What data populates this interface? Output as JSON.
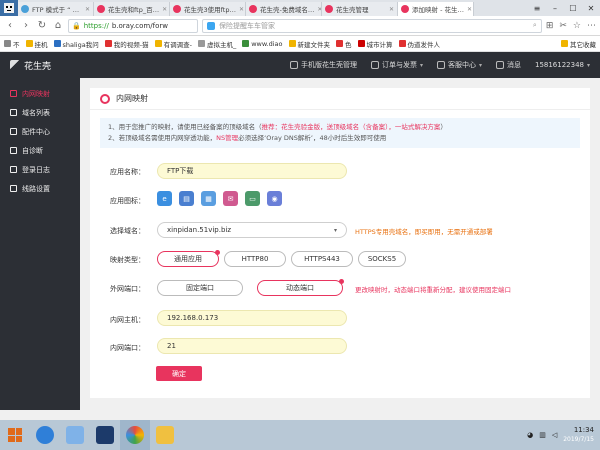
{
  "browser": {
    "avatar": "",
    "tabs": [
      {
        "label": "FTP 模式于 “ …",
        "color": "#4aa0d8",
        "active": false
      },
      {
        "label": "花生壳和ftp_百…",
        "color": "#e8345e",
        "active": false
      },
      {
        "label": "花生壳3使用ftp…",
        "color": "#e8345e",
        "active": false
      },
      {
        "label": "花生壳-免费域名…",
        "color": "#e8345e",
        "active": false
      },
      {
        "label": "花生壳管理",
        "color": "#e8345e",
        "active": false
      },
      {
        "label": "添加映射 - 花生…",
        "color": "#e8345e",
        "active": true
      }
    ],
    "url_scheme": "https://",
    "url_host": "b.oray.com/forw",
    "search_placeholder": "保险提醒车车管家",
    "bookmarks": [
      {
        "label": "不",
        "color": "#888"
      },
      {
        "label": "挂机",
        "color": "#f0b400"
      },
      {
        "label": "shaliga我问",
        "color": "#2b6fc2"
      },
      {
        "label": "我的视频-猫",
        "color": "#e03030"
      },
      {
        "label": "有调调查-",
        "color": "#f0b400"
      },
      {
        "label": "虚拟主机_",
        "color": "#999"
      },
      {
        "label": "www.diao",
        "color": "#3b8f3b"
      },
      {
        "label": "新建文件夹",
        "color": "#f0b400"
      },
      {
        "label": "色",
        "color": "#e03030"
      },
      {
        "label": "城市计算",
        "color": "#c00"
      },
      {
        "label": "伪道发件人",
        "color": "#e03030"
      }
    ],
    "bookmarks_more": "其它收藏"
  },
  "app": {
    "logo": "花生壳",
    "header_items": [
      {
        "label": "手机版花生壳管理",
        "caret": false
      },
      {
        "label": "订单与发票",
        "caret": true
      },
      {
        "label": "客服中心",
        "caret": true
      },
      {
        "label": "消息",
        "caret": false
      },
      {
        "label": "15816122348",
        "caret": true
      }
    ],
    "sidebar": [
      {
        "label": "内网映射",
        "active": true
      },
      {
        "label": "域名列表",
        "active": false
      },
      {
        "label": "配件中心",
        "active": false
      },
      {
        "label": "自诊断",
        "active": false
      },
      {
        "label": "登录日志",
        "active": false
      },
      {
        "label": "线路设置",
        "active": false
      }
    ]
  },
  "page": {
    "title": "内网映射",
    "notice": {
      "line1_prefix": "1、用于您推广的映射，请使用已经备案的顶级域名（",
      "line1_em": "推荐：花生壳验金版，送顶级域名（含备案），一站式解决方案",
      "line1_suffix": "）",
      "line2_prefix": "2、若顶级域名需使用内网穿透功能，",
      "line2_em": "NS管理",
      "line2_suffix": "必须选择‘Oray DNS解析’，48小时后生效即可使用"
    },
    "form": {
      "app_name_label": "应用名称：",
      "app_name_value": "FTP下载",
      "app_icon_label": "应用图标：",
      "domain_label": "选择域名：",
      "domain_value": "xinpidan.51vip.biz",
      "domain_hint": "HTTPS专用壳域名，即买即用，无需开通或部署",
      "type_label": "映射类型：",
      "types": [
        "通用应用",
        "HTTP80",
        "HTTPS443",
        "SOCKS5"
      ],
      "port_label": "外网端口：",
      "ports": [
        "固定端口",
        "动态端口"
      ],
      "port_hint": "更改映射时，动态端口将重新分配，建议使用固定端口",
      "host_label": "内网主机：",
      "host_value": "192.168.0.173",
      "inner_port_label": "内网端口：",
      "inner_port_value": "21",
      "submit": "确定"
    },
    "icons": [
      {
        "name": "ie-icon",
        "color": "#3b8fe0",
        "glyph": "e"
      },
      {
        "name": "document-icon",
        "color": "#4a7fd0",
        "glyph": "▤"
      },
      {
        "name": "table-icon",
        "color": "#5a9ee0",
        "glyph": "▦"
      },
      {
        "name": "mail-icon",
        "color": "#d05a90",
        "glyph": "✉"
      },
      {
        "name": "server-icon",
        "color": "#4c9a6a",
        "glyph": "▭"
      },
      {
        "name": "camera-icon",
        "color": "#6a7fd8",
        "glyph": "◉"
      }
    ]
  },
  "taskbar": {
    "time": "11:34",
    "date": "2019/7/15"
  }
}
